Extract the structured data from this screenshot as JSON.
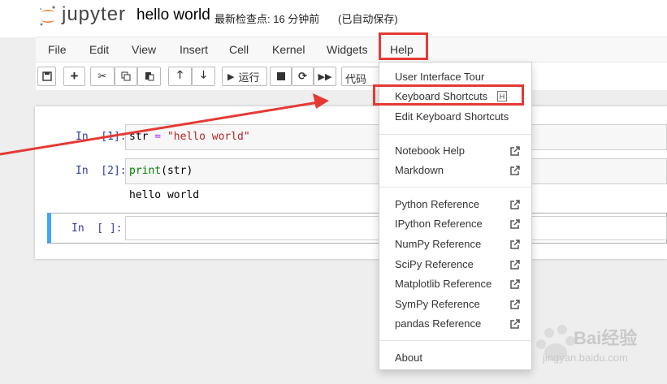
{
  "header": {
    "logo_text": "jupyter",
    "notebook_title": "hello world",
    "checkpoint": "最新检查点: 16 分钟前",
    "autosave": "(已自动保存)"
  },
  "menubar": {
    "items": [
      "File",
      "Edit",
      "View",
      "Insert",
      "Cell",
      "Kernel",
      "Widgets",
      "Help"
    ]
  },
  "toolbar": {
    "run_label": "运行",
    "cell_type": "代码"
  },
  "cells": [
    {
      "prompt": "In  [1]:",
      "code_var": "str",
      "code_op": " = ",
      "code_str": "\"hello world\""
    },
    {
      "prompt": "In  [2]:",
      "code_fn": "print",
      "code_args": "(str)",
      "output": "hello world"
    },
    {
      "prompt": "In  [ ]:",
      "code": ""
    }
  ],
  "help_menu": {
    "items": [
      "User Interface Tour",
      "Keyboard Shortcuts",
      "Edit Keyboard Shortcuts",
      "Notebook Help",
      "Markdown",
      "Python Reference",
      "IPython Reference",
      "NumPy Reference",
      "SciPy Reference",
      "Matplotlib Reference",
      "SymPy Reference",
      "pandas Reference",
      "About"
    ],
    "shortcut_key": "H"
  },
  "watermark": {
    "brand": "Bai经验",
    "url": "jingyan.baidu.com"
  },
  "colors": {
    "highlight": "#e53935",
    "selected_cell_border": "#42a5f5",
    "prompt": "#303f9f",
    "logo_orange": "#f37726"
  }
}
